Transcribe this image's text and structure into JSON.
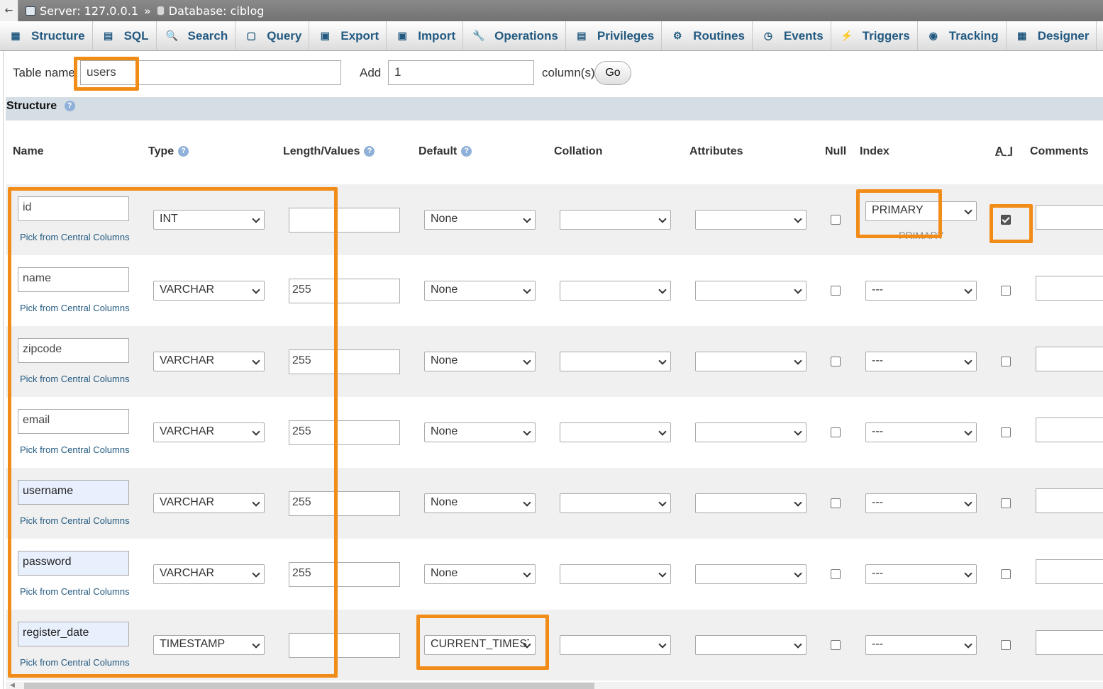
{
  "breadcrumb": {
    "back": "←",
    "server": "Server: 127.0.0.1",
    "separator": "»",
    "database": "Database: ciblog"
  },
  "tabs": [
    {
      "label": "Structure",
      "icon": "structure-icon",
      "glyph": "▦"
    },
    {
      "label": "SQL",
      "icon": "sql-icon",
      "glyph": "▤"
    },
    {
      "label": "Search",
      "icon": "search-icon",
      "glyph": "🔍"
    },
    {
      "label": "Query",
      "icon": "query-icon",
      "glyph": "▢"
    },
    {
      "label": "Export",
      "icon": "export-icon",
      "glyph": "▣"
    },
    {
      "label": "Import",
      "icon": "import-icon",
      "glyph": "▣"
    },
    {
      "label": "Operations",
      "icon": "wrench-icon",
      "glyph": "🔧"
    },
    {
      "label": "Privileges",
      "icon": "privileges-icon",
      "glyph": "▤"
    },
    {
      "label": "Routines",
      "icon": "routines-icon",
      "glyph": "⚙"
    },
    {
      "label": "Events",
      "icon": "clock-icon",
      "glyph": "◷"
    },
    {
      "label": "Triggers",
      "icon": "triggers-icon",
      "glyph": "⚡"
    },
    {
      "label": "Tracking",
      "icon": "eye-icon",
      "glyph": "◉"
    },
    {
      "label": "Designer",
      "icon": "designer-icon",
      "glyph": "▦"
    }
  ],
  "more_glyph": "▼",
  "form": {
    "table_name_label": "Table name:",
    "table_name_value": "users",
    "add_label": "Add",
    "add_value": "1",
    "columns_label": "column(s)",
    "go_label": "Go"
  },
  "section_title": "Structure",
  "help_glyph": "?",
  "headers": {
    "name": "Name",
    "type": "Type",
    "length": "Length/Values",
    "default": "Default",
    "collation": "Collation",
    "attributes": "Attributes",
    "null": "Null",
    "index": "Index",
    "ai": "A_I",
    "comments": "Comments"
  },
  "pick_label": "Pick from Central Columns",
  "primary_ghost": "PRIMARY",
  "columns": [
    {
      "name": "id",
      "type": "INT",
      "length": "",
      "default": "None",
      "collation": "",
      "attributes": "",
      "null": false,
      "index": "PRIMARY",
      "ai": true
    },
    {
      "name": "name",
      "type": "VARCHAR",
      "length": "255",
      "default": "None",
      "collation": "",
      "attributes": "",
      "null": false,
      "index": "---",
      "ai": false
    },
    {
      "name": "zipcode",
      "type": "VARCHAR",
      "length": "255",
      "default": "None",
      "collation": "",
      "attributes": "",
      "null": false,
      "index": "---",
      "ai": false
    },
    {
      "name": "email",
      "type": "VARCHAR",
      "length": "255",
      "default": "None",
      "collation": "",
      "attributes": "",
      "null": false,
      "index": "---",
      "ai": false
    },
    {
      "name": "username",
      "type": "VARCHAR",
      "length": "255",
      "default": "None",
      "collation": "",
      "attributes": "",
      "null": false,
      "index": "---",
      "ai": false
    },
    {
      "name": "password",
      "type": "VARCHAR",
      "length": "255",
      "default": "None",
      "collation": "",
      "attributes": "",
      "null": false,
      "index": "---",
      "ai": false
    },
    {
      "name": "register_date",
      "type": "TIMESTAMP",
      "length": "",
      "default": "CURRENT_TIMESTAMP",
      "collation": "",
      "attributes": "",
      "null": false,
      "index": "---",
      "ai": false
    }
  ],
  "colors": {
    "highlight": "#f28c18",
    "tab_text": "#235a81",
    "structure_bar": "#d5dde5",
    "row_alt": "#f0f0f0"
  }
}
